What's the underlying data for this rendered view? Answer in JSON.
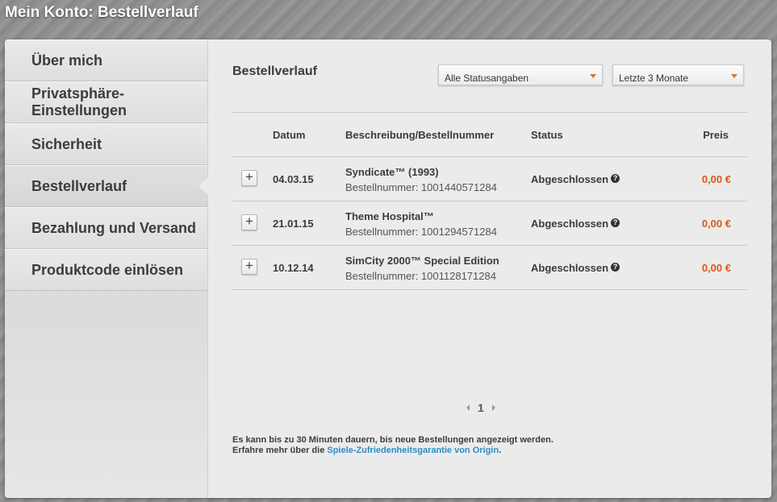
{
  "window": {
    "title": "Mein Konto: Bestellverlauf"
  },
  "sidebar": {
    "items": [
      {
        "label": "Über mich"
      },
      {
        "label": "Privatsphäre-\nEinstellungen"
      },
      {
        "label": "Sicherheit"
      },
      {
        "label": "Bestellverlauf",
        "active": true
      },
      {
        "label": "Bezahlung und Versand"
      },
      {
        "label": "Produktcode einlösen"
      }
    ]
  },
  "main": {
    "section_title": "Bestellverlauf",
    "filters": {
      "status": "Alle Statusangaben",
      "period": "Letzte 3 Monate"
    },
    "table": {
      "headers": {
        "date": "Datum",
        "description": "Beschreibung/Bestellnummer",
        "status": "Status",
        "price": "Preis"
      },
      "rows": [
        {
          "date": "04.03.15",
          "name": "Syndicate™ (1993)",
          "order": "Bestellnummer: 1001440571284",
          "status": "Abgeschlossen",
          "price": "0,00 €"
        },
        {
          "date": "21.01.15",
          "name": "Theme Hospital™",
          "order": "Bestellnummer: 1001294571284",
          "status": "Abgeschlossen",
          "price": "0,00 €"
        },
        {
          "date": "10.12.14",
          "name": "SimCity 2000™ Special Edition",
          "order": "Bestellnummer: 1001128171284",
          "status": "Abgeschlossen",
          "price": "0,00 €"
        }
      ]
    },
    "pagination": {
      "current_page": "1"
    },
    "footer_note": {
      "line1": "Es kann bis zu 30 Minuten dauern, bis neue Bestellungen angezeigt werden.",
      "line2_prefix": "Erfahre mehr über die ",
      "link": "Spiele-Zufriedenheitsgarantie von Origin",
      "line2_suffix": "."
    }
  },
  "icons": {
    "expand": "plus-icon",
    "help": "question-circle-icon",
    "dropdown": "caret-down-icon"
  },
  "colors": {
    "price": "#d9571a",
    "link": "#2b8ec7",
    "dropdown_arrow": "#e0761a"
  }
}
